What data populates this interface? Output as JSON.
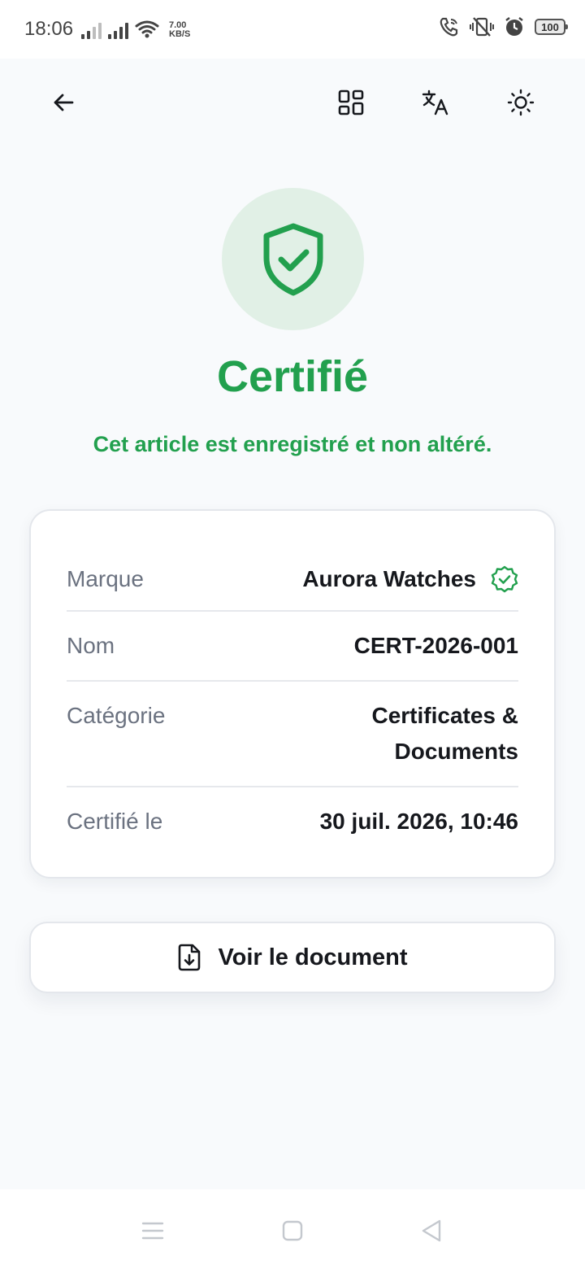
{
  "status_bar": {
    "time": "18:06",
    "net_speed_value": "7.00",
    "net_speed_unit": "KB/S",
    "battery": "100",
    "icons": [
      "signal-1-icon",
      "signal-2-icon",
      "wifi-icon",
      "wifi-call-icon",
      "vibrate-icon",
      "alarm-icon",
      "battery-icon"
    ]
  },
  "toolbar": {
    "icons": [
      "back-arrow-icon",
      "qr-grid-icon",
      "translate-icon",
      "sun-icon"
    ]
  },
  "hero": {
    "icon": "shield-check-icon",
    "title": "Certifié",
    "subtitle": "Cet article est enregistré et non altéré."
  },
  "details": {
    "rows": [
      {
        "label": "Marque",
        "value": "Aurora Watches",
        "verified_icon": "verified-badge-icon"
      },
      {
        "label": "Nom",
        "value": "CERT-2026-001"
      },
      {
        "label": "Catégorie",
        "value_line1": "Certificates &",
        "value_line2": "Documents"
      },
      {
        "label": "Certifié le",
        "value": "30 juil. 2026, 10:46"
      }
    ]
  },
  "document_button": {
    "label": "Voir le document",
    "icon": "file-download-icon"
  },
  "colors": {
    "accent_green": "#22a04e",
    "hero_circle": "#e1f0e6",
    "background": "#f8fafc"
  },
  "nav_bar": {
    "icons": [
      "menu-icon",
      "home-square-icon",
      "back-triangle-icon"
    ]
  }
}
